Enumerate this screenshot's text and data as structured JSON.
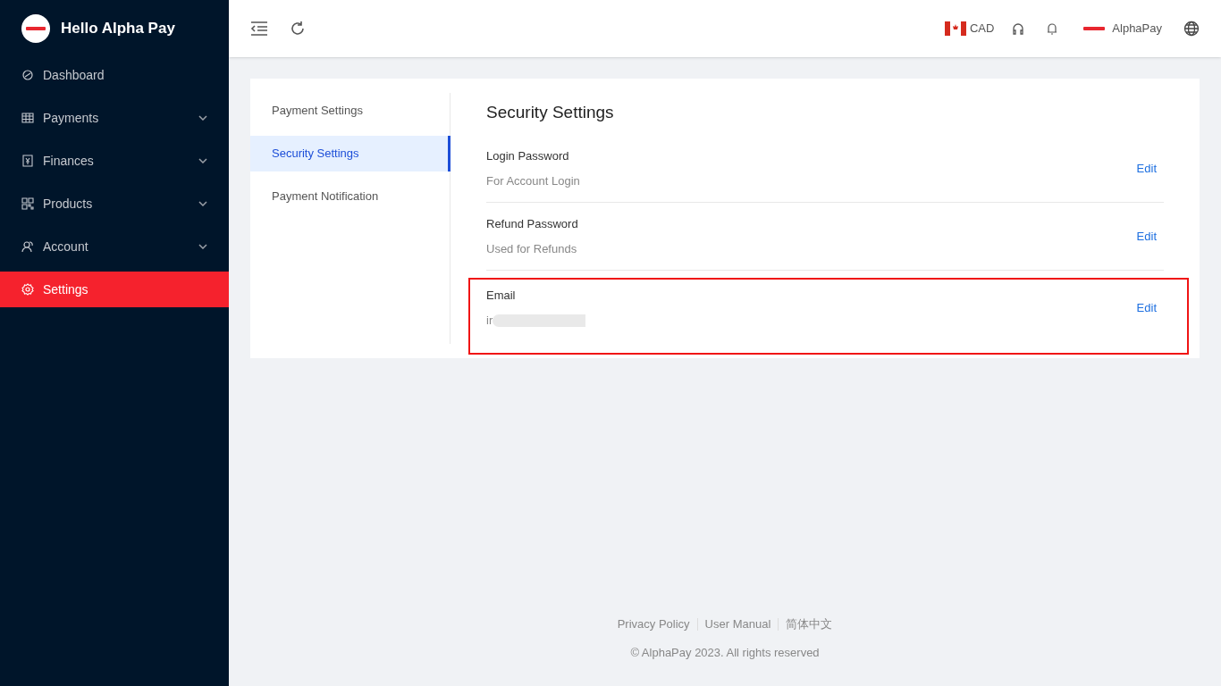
{
  "sidebar": {
    "brand": "Hello Alpha Pay",
    "items": [
      {
        "label": "Dashboard",
        "has_submenu": false,
        "selected": false
      },
      {
        "label": "Payments",
        "has_submenu": true,
        "selected": false
      },
      {
        "label": "Finances",
        "has_submenu": true,
        "selected": false
      },
      {
        "label": "Products",
        "has_submenu": true,
        "selected": false
      },
      {
        "label": "Account",
        "has_submenu": true,
        "selected": false
      },
      {
        "label": "Settings",
        "has_submenu": false,
        "selected": true
      }
    ]
  },
  "topbar": {
    "currency": "CAD",
    "account": "AlphaPay"
  },
  "settings_menu": [
    {
      "label": "Payment Settings",
      "selected": false
    },
    {
      "label": "Security Settings",
      "selected": true
    },
    {
      "label": "Payment Notification",
      "selected": false
    }
  ],
  "panel": {
    "title": "Security Settings",
    "rows": [
      {
        "label": "Login Password",
        "value": "For Account Login",
        "action": "Edit",
        "highlighted": false,
        "redacted": false
      },
      {
        "label": "Refund Password",
        "value": "Used for Refunds",
        "action": "Edit",
        "highlighted": false,
        "redacted": false
      },
      {
        "label": "Email",
        "value": "ir",
        "action": "Edit",
        "highlighted": true,
        "redacted": true
      }
    ]
  },
  "footer": {
    "links": [
      "Privacy Policy",
      "User Manual",
      "简体中文"
    ],
    "copyright": "© AlphaPay 2023. All rights reserved"
  }
}
